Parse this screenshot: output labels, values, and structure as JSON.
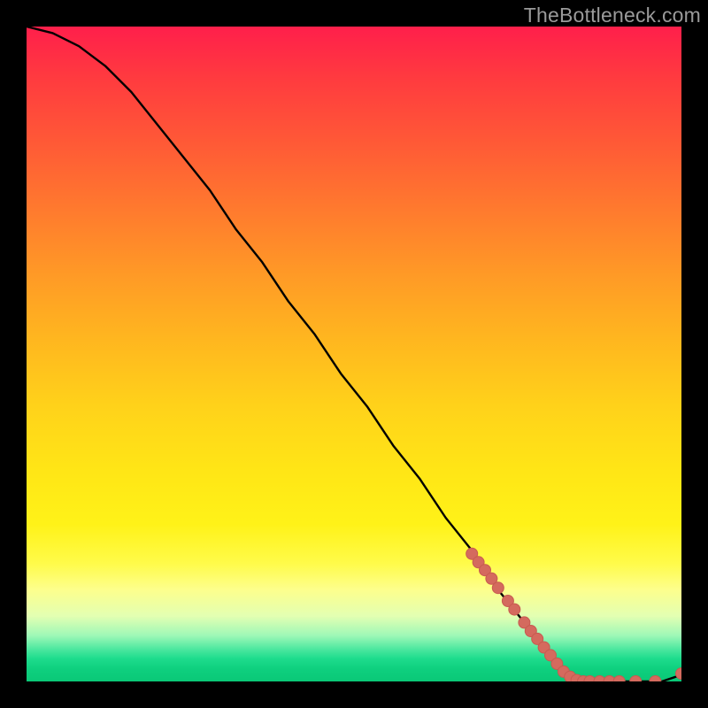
{
  "watermark": "TheBottleneck.com",
  "colors": {
    "background": "#000000",
    "curve": "#000000",
    "marker_fill": "#d46a5e",
    "marker_stroke": "#c85a50",
    "gradient_top": "#ff1f4b",
    "gradient_bottom": "#0ac877"
  },
  "chart_data": {
    "type": "line",
    "title": "",
    "xlabel": "",
    "ylabel": "",
    "xlim": [
      0,
      100
    ],
    "ylim": [
      0,
      100
    ],
    "grid": false,
    "legend": false,
    "annotations": [
      "TheBottleneck.com"
    ],
    "series": [
      {
        "name": "bottleneck-curve",
        "x": [
          0,
          4,
          8,
          12,
          16,
          20,
          24,
          28,
          32,
          36,
          40,
          44,
          48,
          52,
          56,
          60,
          64,
          68,
          72,
          76,
          80,
          83,
          86,
          88,
          91,
          94,
          97,
          100
        ],
        "y": [
          100,
          99,
          97,
          94,
          90,
          85,
          80,
          75,
          69,
          64,
          58,
          53,
          47,
          42,
          36,
          31,
          25,
          20,
          14,
          9,
          4,
          1,
          0,
          0,
          0,
          0,
          0,
          1
        ]
      }
    ],
    "markers": [
      {
        "x": 68.0,
        "y": 19.5
      },
      {
        "x": 69.0,
        "y": 18.2
      },
      {
        "x": 70.0,
        "y": 17.0
      },
      {
        "x": 71.0,
        "y": 15.7
      },
      {
        "x": 72.0,
        "y": 14.3
      },
      {
        "x": 73.5,
        "y": 12.3
      },
      {
        "x": 74.5,
        "y": 11.0
      },
      {
        "x": 76.0,
        "y": 9.0
      },
      {
        "x": 77.0,
        "y": 7.7
      },
      {
        "x": 78.0,
        "y": 6.5
      },
      {
        "x": 79.0,
        "y": 5.2
      },
      {
        "x": 80.0,
        "y": 4.0
      },
      {
        "x": 81.0,
        "y": 2.7
      },
      {
        "x": 82.0,
        "y": 1.5
      },
      {
        "x": 83.0,
        "y": 0.7
      },
      {
        "x": 84.0,
        "y": 0.2
      },
      {
        "x": 85.0,
        "y": 0.0
      },
      {
        "x": 86.0,
        "y": 0.0
      },
      {
        "x": 87.5,
        "y": 0.0
      },
      {
        "x": 89.0,
        "y": 0.0
      },
      {
        "x": 90.5,
        "y": 0.0
      },
      {
        "x": 93.0,
        "y": 0.0
      },
      {
        "x": 96.0,
        "y": 0.0
      },
      {
        "x": 100.0,
        "y": 1.2
      }
    ]
  }
}
